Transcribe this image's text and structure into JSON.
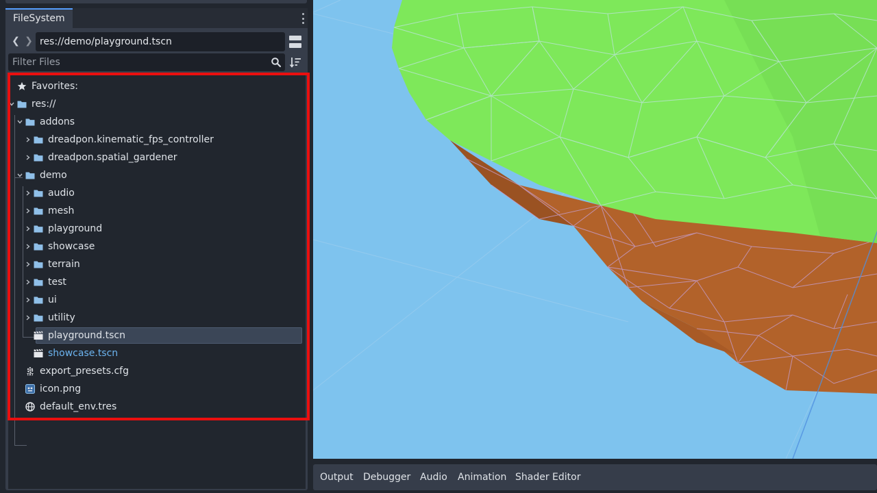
{
  "dock": {
    "tab_label": "FileSystem",
    "path_value": "res://demo/playground.tscn",
    "filter_placeholder": "Filter Files"
  },
  "tree": {
    "favorites_label": "Favorites:",
    "root_label": "res://",
    "addons_label": "addons",
    "addon_items": [
      "dreadpon.kinematic_fps_controller",
      "dreadpon.spatial_gardener"
    ],
    "demo_label": "demo",
    "demo_folders": [
      "audio",
      "mesh",
      "playground",
      "showcase",
      "terrain",
      "test",
      "ui",
      "utility"
    ],
    "demo_files": [
      {
        "label": "playground.tscn",
        "selected": true
      },
      {
        "label": "showcase.tscn",
        "selected": false
      }
    ],
    "root_files": [
      {
        "label": "export_presets.cfg",
        "icon": "config-icon"
      },
      {
        "label": "icon.png",
        "icon": "image-icon"
      },
      {
        "label": "default_env.tres",
        "icon": "environment-icon"
      }
    ]
  },
  "bottom_panel": {
    "tabs": [
      "Output",
      "Debugger",
      "Audio",
      "Animation",
      "Shader Editor"
    ]
  },
  "colors": {
    "accent": "#569eff",
    "folder": "#8fbfe8",
    "link_file": "#6cb4f0",
    "highlight_box": "#ea0f0f",
    "viewport_sky": "#7ec3ee",
    "terrain_top": "#7ee85a",
    "terrain_side": "#b2622a"
  }
}
